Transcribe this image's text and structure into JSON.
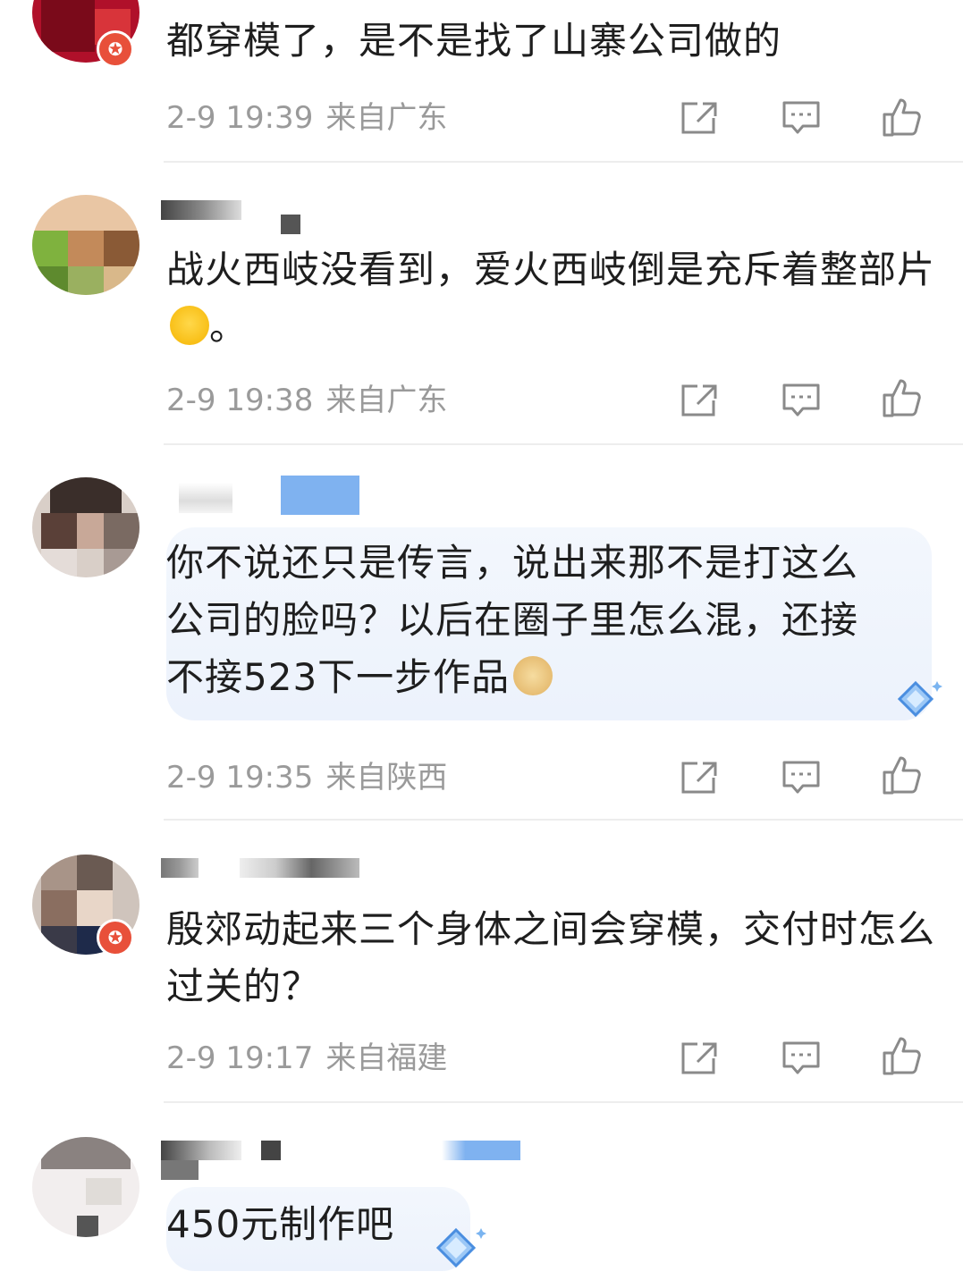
{
  "comments": [
    {
      "text": "都穿模了，是不是找了山寨公司做的",
      "date": "2-9 19:39",
      "location": "来自广东"
    },
    {
      "text": "战火西岐没看到，爱火西岐倒是充斥着整部片",
      "text_suffix": "。",
      "emoji": "laughing-crying-emoji",
      "date": "2-9 19:38",
      "location": "来自广东"
    },
    {
      "text_line1": "你不说还只是传言，说出来那不是打这么",
      "text_line2": "公司的脸吗？以后在圈子里怎么混，还接",
      "text_line3": "不接523下一步作品",
      "emoji": "doge-emoji",
      "date": "2-9 19:35",
      "location": "来自陕西"
    },
    {
      "text": "殷郊动起来三个身体之间会穿模，交付时怎么过关的？",
      "date": "2-9 19:17",
      "location": "来自福建"
    },
    {
      "text": "450元制作吧"
    }
  ],
  "icons": {
    "share": "share-icon",
    "reply": "comment-icon",
    "like": "thumbs-up-icon",
    "verified": "verified-badge-icon"
  },
  "colors": {
    "meta_text": "#9a9a9a",
    "bubble": "#eef3fc",
    "badge": "#e8503a",
    "icon": "#8a8a8a"
  }
}
